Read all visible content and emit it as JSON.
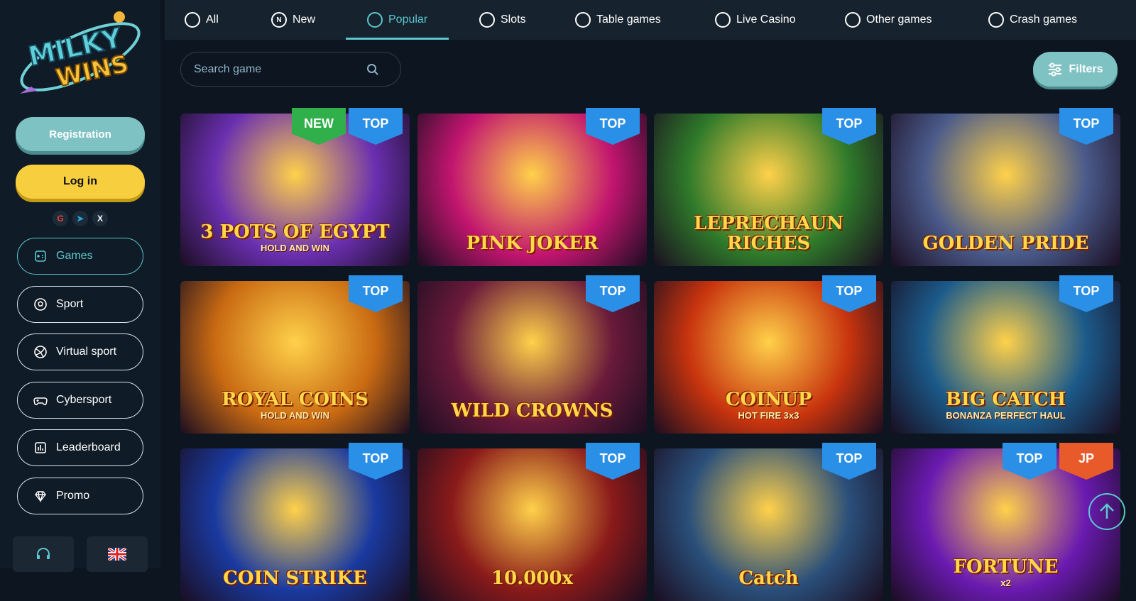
{
  "brand": {
    "logo_line1": "MILKY",
    "logo_line2": "WINS"
  },
  "sidebar": {
    "register_label": "Registration",
    "login_label": "Log in",
    "socials": [
      {
        "icon": "google-icon",
        "glyph": "G"
      },
      {
        "icon": "telegram-icon",
        "glyph": "➤"
      },
      {
        "icon": "x-icon",
        "glyph": "X"
      }
    ],
    "items": [
      {
        "label": "Games",
        "icon": "gamepad-icon",
        "active": true
      },
      {
        "label": "Sport",
        "icon": "soccer-ball-icon"
      },
      {
        "label": "Virtual sport",
        "icon": "virtual-ball-icon"
      },
      {
        "label": "Cybersport",
        "icon": "controller-icon"
      },
      {
        "label": "Leaderboard",
        "icon": "leaderboard-icon"
      },
      {
        "label": "Promo",
        "icon": "diamond-icon"
      }
    ]
  },
  "tabs": [
    {
      "label": "All",
      "icon": "grid-icon"
    },
    {
      "label": "New",
      "icon": "new-icon",
      "glyph": "N"
    },
    {
      "label": "Popular",
      "icon": "popular-icon",
      "active": true
    },
    {
      "label": "Slots",
      "icon": "slots-icon"
    },
    {
      "label": "Table games",
      "icon": "table-games-icon"
    },
    {
      "label": "Live Casino",
      "icon": "live-casino-icon"
    },
    {
      "label": "Other games",
      "icon": "other-games-icon"
    },
    {
      "label": "Crash games",
      "icon": "crash-games-icon"
    }
  ],
  "search": {
    "placeholder": "Search game"
  },
  "filters_label": "Filters",
  "games": [
    {
      "title": "3 POTS OF EGYPT",
      "subtitle": "HOLD AND WIN",
      "badges": [
        "NEW",
        "TOP"
      ],
      "bg": "#6a2fb0"
    },
    {
      "title": "PINK JOKER",
      "subtitle": "",
      "badges": [
        "TOP"
      ],
      "bg": "#c2156f"
    },
    {
      "title": "LEPRECHAUN RICHES",
      "subtitle": "",
      "badges": [
        "TOP"
      ],
      "bg": "#2f7a2a"
    },
    {
      "title": "GOLDEN PRIDE",
      "subtitle": "",
      "badges": [
        "TOP"
      ],
      "bg": "#4a5a8a"
    },
    {
      "title": "ROYAL COINS",
      "subtitle": "HOLD AND WIN",
      "badges": [
        "TOP"
      ],
      "bg": "#c96a12"
    },
    {
      "title": "WILD CROWNS",
      "subtitle": "",
      "badges": [
        "TOP"
      ],
      "bg": "#6a1a3a"
    },
    {
      "title": "COINUP",
      "subtitle": "HOT FIRE 3x3",
      "badges": [
        "TOP"
      ],
      "bg": "#c8340e"
    },
    {
      "title": "BIG CATCH",
      "subtitle": "BONANZA PERFECT HAUL",
      "badges": [
        "TOP"
      ],
      "bg": "#1b5a8a"
    },
    {
      "title": "COIN STRIKE",
      "subtitle": "",
      "badges": [
        "TOP"
      ],
      "bg": "#1a3aa0"
    },
    {
      "title": "10.000x",
      "subtitle": "",
      "badges": [
        "TOP"
      ],
      "bg": "#8a1a1a"
    },
    {
      "title": "Catch",
      "subtitle": "",
      "badges": [
        "TOP"
      ],
      "bg": "#2a4f7a"
    },
    {
      "title": "FORTUNE",
      "subtitle": "x2",
      "badges": [
        "TOP",
        "JP"
      ],
      "bg": "#6a1ab0"
    }
  ]
}
